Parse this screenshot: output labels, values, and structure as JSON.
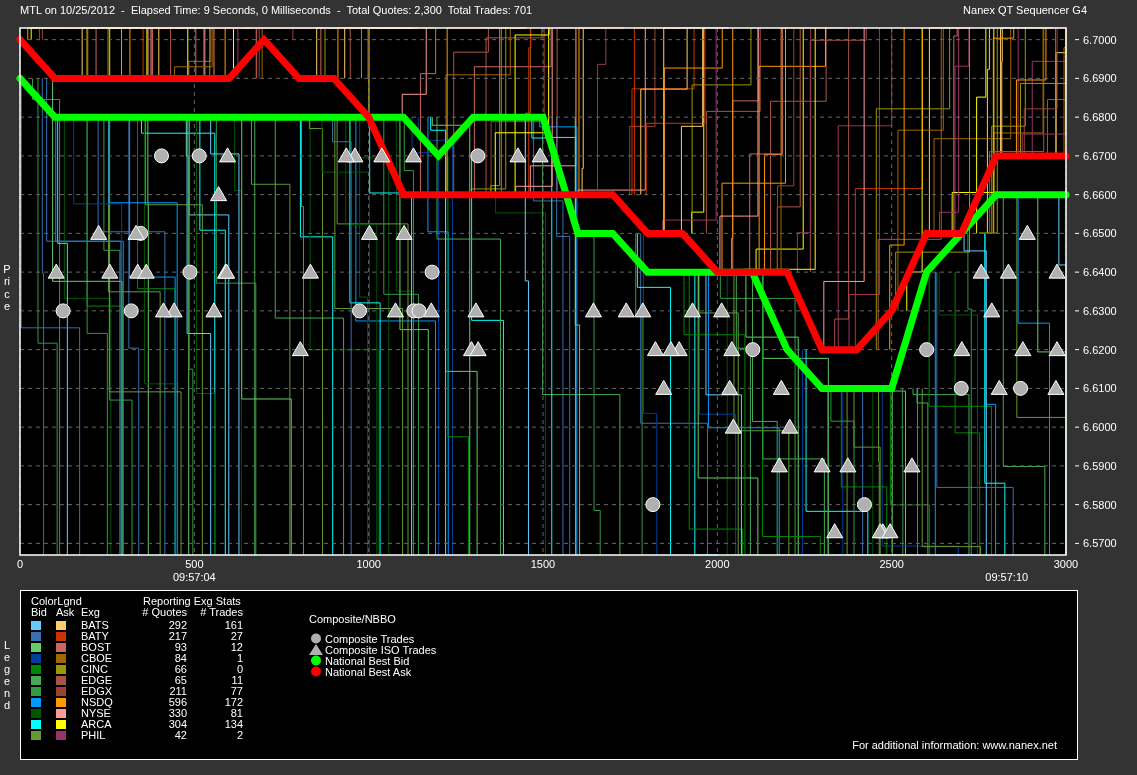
{
  "header": {
    "title": "MTL on 10/25/2012  -  Elapsed Time: 9 Seconds, 0 Milliseconds  -  Total Quotes: 2,300  Total Trades: 701",
    "app_name": "Nanex QT Sequencer G4"
  },
  "chart": {
    "axis_label": "Price",
    "chart_data": {
      "type": "line",
      "grid": true,
      "xlim": [
        0,
        3000
      ],
      "ylim": [
        6.567,
        6.703
      ],
      "xticks": [
        0,
        500,
        1000,
        1500,
        2000,
        2500,
        3000
      ],
      "yticks": [
        {
          "value": 6.7,
          "label": "6.7000"
        },
        {
          "value": 6.69,
          "label": "6.6900"
        },
        {
          "value": 6.68,
          "label": "6.6800"
        },
        {
          "value": 6.67,
          "label": "6.6700"
        },
        {
          "value": 6.66,
          "label": "6.6600"
        },
        {
          "value": 6.65,
          "label": "6.6500"
        },
        {
          "value": 6.64,
          "label": "6.6400"
        },
        {
          "value": 6.63,
          "label": "6.6300"
        },
        {
          "value": 6.62,
          "label": "6.6200"
        },
        {
          "value": 6.61,
          "label": "6.6100"
        },
        {
          "value": 6.6,
          "label": "6.6000"
        },
        {
          "value": 6.59,
          "label": "6.5900"
        },
        {
          "value": 6.58,
          "label": "6.5800"
        },
        {
          "value": 6.57,
          "label": "6.5700"
        }
      ],
      "x": [
        0,
        100,
        200,
        300,
        400,
        500,
        600,
        700,
        800,
        900,
        1000,
        1100,
        1200,
        1300,
        1400,
        1500,
        1600,
        1700,
        1800,
        1900,
        2000,
        2100,
        2200,
        2300,
        2400,
        2500,
        2600,
        2700,
        2800,
        2900,
        3000
      ],
      "series": [
        {
          "name": "National Best Bid",
          "color": "#00ff00",
          "values": [
            6.69,
            6.68,
            6.68,
            6.68,
            6.68,
            6.68,
            6.68,
            6.68,
            6.68,
            6.68,
            6.68,
            6.68,
            6.67,
            6.68,
            6.68,
            6.68,
            6.65,
            6.65,
            6.64,
            6.64,
            6.64,
            6.64,
            6.62,
            6.61,
            6.61,
            6.61,
            6.64,
            6.65,
            6.66,
            6.66,
            6.66
          ]
        },
        {
          "name": "National Best Ask",
          "color": "#ff0000",
          "values": [
            6.7,
            6.69,
            6.69,
            6.69,
            6.69,
            6.69,
            6.69,
            6.7,
            6.69,
            6.69,
            6.68,
            6.66,
            6.66,
            6.66,
            6.66,
            6.66,
            6.66,
            6.66,
            6.65,
            6.65,
            6.64,
            6.64,
            6.64,
            6.62,
            6.62,
            6.63,
            6.65,
            6.65,
            6.67,
            6.67,
            6.67
          ]
        }
      ],
      "annotations": [
        "09:57:04",
        "09:57:10"
      ]
    }
  },
  "legend": {
    "axis_label": "Legend",
    "color_title": "ColorLgnd",
    "stats_title": "Reporting Exg Stats",
    "columns": [
      "Bid",
      "Ask",
      "Exg",
      "# Quotes",
      "# Trades"
    ],
    "exchanges": [
      {
        "name": "BATS",
        "bid": {
          "color": "#66ccff"
        },
        "ask": {
          "color": "#ffcc66"
        },
        "quotes": "292",
        "trades": "161"
      },
      {
        "name": "BATY",
        "bid": {
          "color": "#3a6fb0"
        },
        "ask": {
          "color": "#cc3300"
        },
        "quotes": "217",
        "trades": "27"
      },
      {
        "name": "BOST",
        "bid": {
          "color": "#66cc66"
        },
        "ask": {
          "color": "#cc6666"
        },
        "quotes": "93",
        "trades": "12"
      },
      {
        "name": "CBOE",
        "bid": {
          "color": "#003f99"
        },
        "ask": {
          "color": "#a06600"
        },
        "quotes": "84",
        "trades": "1"
      },
      {
        "name": "CINC",
        "bid": {
          "color": "#008800"
        },
        "ask": {
          "color": "#999900"
        },
        "quotes": "66",
        "trades": "0"
      },
      {
        "name": "EDGE",
        "bid": {
          "color": "#44aa55"
        },
        "ask": {
          "color": "#aa5544"
        },
        "quotes": "65",
        "trades": "11"
      },
      {
        "name": "EDGX",
        "bid": {
          "color": "#339944"
        },
        "ask": {
          "color": "#994433"
        },
        "quotes": "211",
        "trades": "77"
      },
      {
        "name": "NSDQ",
        "bid": {
          "color": "#0099ff"
        },
        "ask": {
          "color": "#ff9900"
        },
        "quotes": "596",
        "trades": "172"
      },
      {
        "name": "NYSE",
        "bid": {
          "color": "#005500"
        },
        "ask": {
          "color": "#ff9999"
        },
        "quotes": "330",
        "trades": "81"
      },
      {
        "name": "ARCA",
        "bid": {
          "color": "#00ffff"
        },
        "ask": {
          "color": "#ffff00"
        },
        "quotes": "304",
        "trades": "134"
      },
      {
        "name": "PHIL",
        "bid": {
          "color": "#669933"
        },
        "ask": {
          "color": "#993366"
        },
        "quotes": "42",
        "trades": "2"
      }
    ],
    "composite_title": "Composite/NBBO",
    "symbols": [
      {
        "kind": "circle",
        "label": "Composite Trades"
      },
      {
        "kind": "triangle",
        "label": "Composite ISO Trades"
      }
    ],
    "footer": "For additional information: www.nanex.net"
  }
}
